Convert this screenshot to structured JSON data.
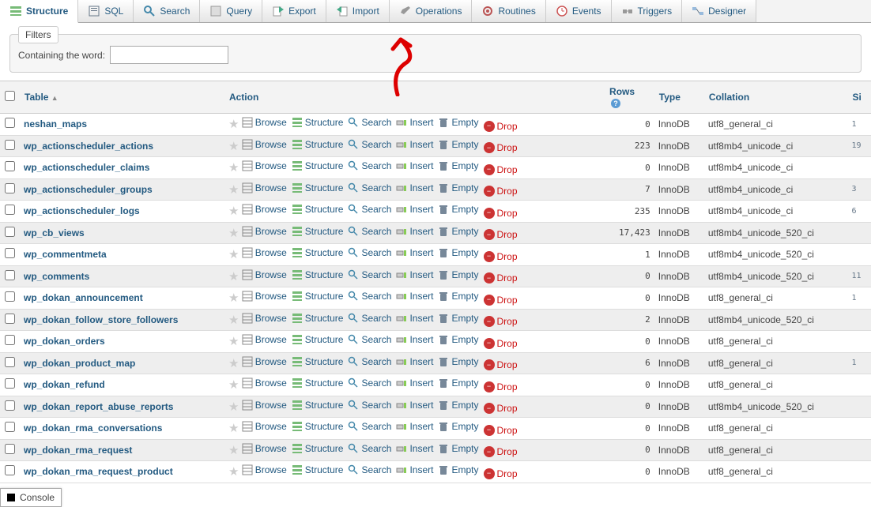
{
  "tabs": [
    {
      "label": "Structure",
      "active": true
    },
    {
      "label": "SQL"
    },
    {
      "label": "Search"
    },
    {
      "label": "Query"
    },
    {
      "label": "Export"
    },
    {
      "label": "Import"
    },
    {
      "label": "Operations"
    },
    {
      "label": "Routines"
    },
    {
      "label": "Events"
    },
    {
      "label": "Triggers"
    },
    {
      "label": "Designer"
    }
  ],
  "filters": {
    "legend": "Filters",
    "label": "Containing the word:",
    "value": ""
  },
  "headers": {
    "table": "Table",
    "action": "Action",
    "rows": "Rows",
    "type": "Type",
    "collation": "Collation",
    "size": "Si"
  },
  "actions": {
    "browse": "Browse",
    "structure": "Structure",
    "search": "Search",
    "insert": "Insert",
    "empty": "Empty",
    "drop": "Drop"
  },
  "rows_data": [
    {
      "name": "neshan_maps",
      "rows": "0",
      "type": "InnoDB",
      "coll": "utf8_general_ci",
      "sz": "1"
    },
    {
      "name": "wp_actionscheduler_actions",
      "rows": "223",
      "type": "InnoDB",
      "coll": "utf8mb4_unicode_ci",
      "sz": "19"
    },
    {
      "name": "wp_actionscheduler_claims",
      "rows": "0",
      "type": "InnoDB",
      "coll": "utf8mb4_unicode_ci",
      "sz": ""
    },
    {
      "name": "wp_actionscheduler_groups",
      "rows": "7",
      "type": "InnoDB",
      "coll": "utf8mb4_unicode_ci",
      "sz": "3"
    },
    {
      "name": "wp_actionscheduler_logs",
      "rows": "235",
      "type": "InnoDB",
      "coll": "utf8mb4_unicode_ci",
      "sz": "6"
    },
    {
      "name": "wp_cb_views",
      "rows": "17,423",
      "type": "InnoDB",
      "coll": "utf8mb4_unicode_520_ci",
      "sz": ""
    },
    {
      "name": "wp_commentmeta",
      "rows": "1",
      "type": "InnoDB",
      "coll": "utf8mb4_unicode_520_ci",
      "sz": ""
    },
    {
      "name": "wp_comments",
      "rows": "0",
      "type": "InnoDB",
      "coll": "utf8mb4_unicode_520_ci",
      "sz": "11"
    },
    {
      "name": "wp_dokan_announcement",
      "rows": "0",
      "type": "InnoDB",
      "coll": "utf8_general_ci",
      "sz": "1"
    },
    {
      "name": "wp_dokan_follow_store_followers",
      "rows": "2",
      "type": "InnoDB",
      "coll": "utf8mb4_unicode_520_ci",
      "sz": ""
    },
    {
      "name": "wp_dokan_orders",
      "rows": "0",
      "type": "InnoDB",
      "coll": "utf8_general_ci",
      "sz": ""
    },
    {
      "name": "wp_dokan_product_map",
      "rows": "6",
      "type": "InnoDB",
      "coll": "utf8_general_ci",
      "sz": "1"
    },
    {
      "name": "wp_dokan_refund",
      "rows": "0",
      "type": "InnoDB",
      "coll": "utf8_general_ci",
      "sz": ""
    },
    {
      "name": "wp_dokan_report_abuse_reports",
      "rows": "0",
      "type": "InnoDB",
      "coll": "utf8mb4_unicode_520_ci",
      "sz": ""
    },
    {
      "name": "wp_dokan_rma_conversations",
      "rows": "0",
      "type": "InnoDB",
      "coll": "utf8_general_ci",
      "sz": ""
    },
    {
      "name": "wp_dokan_rma_request",
      "rows": "0",
      "type": "InnoDB",
      "coll": "utf8_general_ci",
      "sz": ""
    },
    {
      "name": "wp_dokan_rma_request_product",
      "rows": "0",
      "type": "InnoDB",
      "coll": "utf8_general_ci",
      "sz": ""
    }
  ],
  "console": "Console"
}
